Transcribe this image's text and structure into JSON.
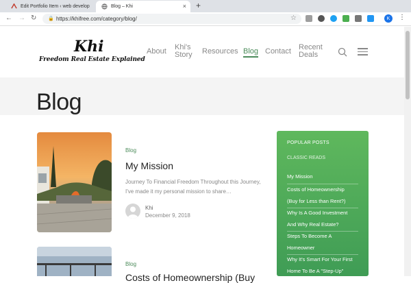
{
  "browser": {
    "tabs": [
      {
        "title": "Edit Portfolio Item ‹ web develop",
        "active": false
      },
      {
        "title": "Blog – Khi",
        "active": true
      }
    ],
    "url": "https://khifree.com/category/blog/",
    "profile_initial": "K"
  },
  "site": {
    "logo": "Khi",
    "tagline": "Freedom Real Estate Explained",
    "nav": [
      {
        "label": "About"
      },
      {
        "label1": "Khi's",
        "label2": "Story"
      },
      {
        "label": "Resources"
      },
      {
        "label": "Blog"
      },
      {
        "label": "Contact"
      },
      {
        "label1": "Recent",
        "label2": "Deals"
      }
    ]
  },
  "hero": {
    "title": "Blog"
  },
  "posts": [
    {
      "category": "Blog",
      "title": "My Mission",
      "excerpt": "Journey To Financial Freedom Throughout this Journey, I've made it my personal mission to share…",
      "author": "Khi",
      "date": "December 9, 2018"
    },
    {
      "category": "Blog",
      "title": "Costs of Homeownership (Buy"
    }
  ],
  "sidebar": {
    "title": "POPULAR POSTS",
    "subtitle": "CLASSIC READS",
    "links": [
      {
        "line1": "My Mission",
        "line2": ""
      },
      {
        "line1": "Costs of Homeownership",
        "line2": "(Buy for Less than Rent?)"
      },
      {
        "line1": "Why Is A Good Investment",
        "line2": "And Why Real Estate?"
      },
      {
        "line1": "Steps To Become A",
        "line2": "Homeowner"
      },
      {
        "line1": "Why It's Smart For Your First",
        "line2": "Home To Be A \"Step-Up\""
      }
    ]
  },
  "colors": {
    "accent_green": "#4b8b5a",
    "widget_green": "#55ae5a"
  }
}
